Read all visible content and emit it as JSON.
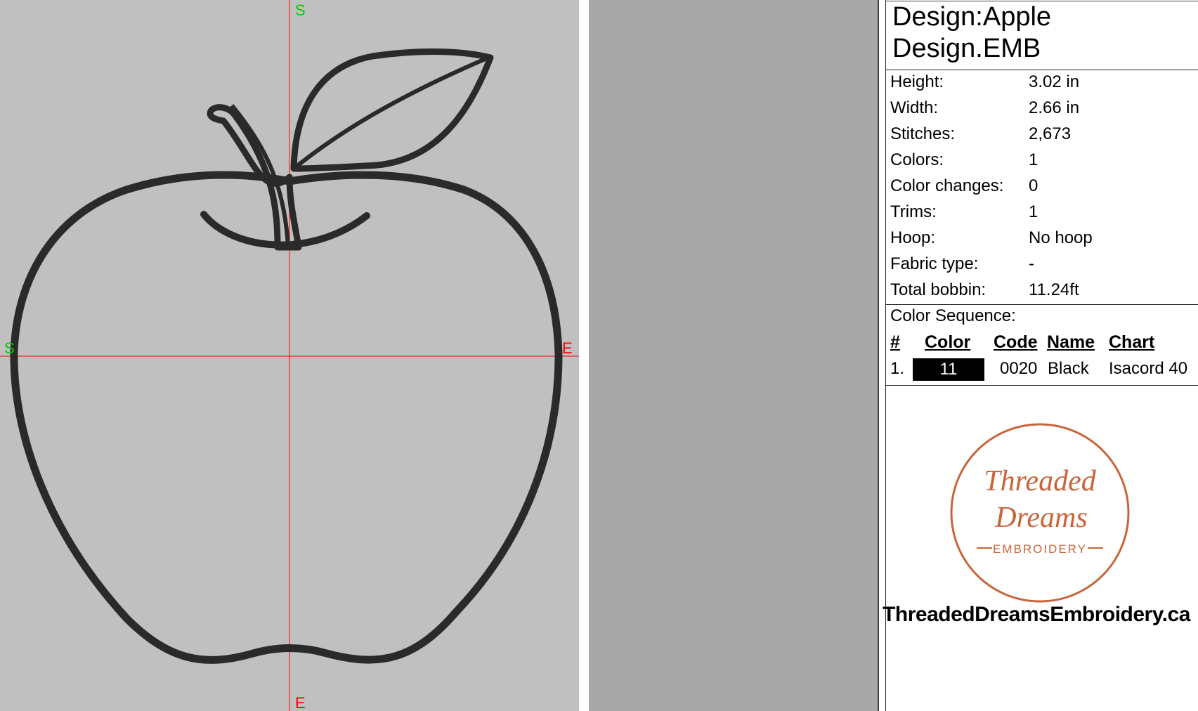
{
  "canvas": {
    "markers": {
      "top": "S",
      "bottom": "E",
      "left": "S",
      "right": "E"
    },
    "colors": {
      "background": "#c0c0c0",
      "guide_line": "#ff0000",
      "start_marker": "#00cc00",
      "end_marker": "#ff0000",
      "stitch": "#2a2a2a"
    }
  },
  "design": {
    "title": "Design:Apple",
    "filename": "Design.EMB"
  },
  "properties": [
    {
      "label": "Height:",
      "value": "3.02 in"
    },
    {
      "label": "Width:",
      "value": "2.66 in"
    },
    {
      "label": "Stitches:",
      "value": "2,673"
    },
    {
      "label": "Colors:",
      "value": "1"
    },
    {
      "label": "Color changes:",
      "value": "0"
    },
    {
      "label": "Trims:",
      "value": "1"
    },
    {
      "label": "Hoop:",
      "value": "No hoop"
    },
    {
      "label": "Fabric type:",
      "value": "-"
    },
    {
      "label": "Total bobbin:",
      "value": "11.24ft"
    }
  ],
  "color_sequence": {
    "title": "Color Sequence:",
    "headers": [
      "#",
      "Color",
      "Code",
      "Name",
      "Chart"
    ],
    "rows": [
      {
        "index": "1.",
        "color": "11",
        "swatch": "#000000",
        "code": "0020",
        "name": "Black",
        "chart": "Isacord 40"
      }
    ]
  },
  "logo": {
    "line1": "Threaded",
    "line2": "Dreams",
    "line3": "EMBROIDERY",
    "color": "#c8643a"
  },
  "website": "ThreadedDreamsEmbroidery.ca"
}
